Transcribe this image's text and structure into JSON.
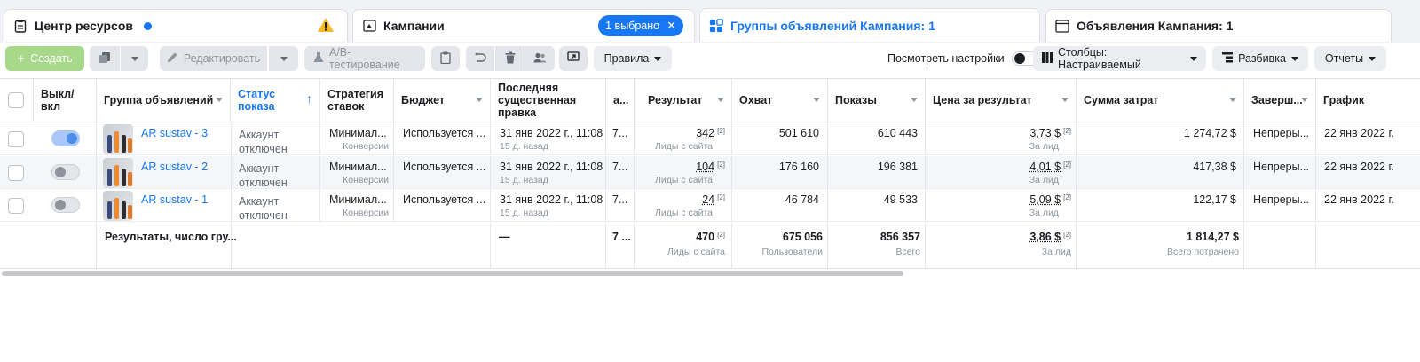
{
  "tabs": {
    "resources": "Центр ресурсов",
    "campaigns": "Кампании",
    "selected_pill": "1 выбрано",
    "adsets": "Группы объявлений Кампания: 1",
    "ads": "Объявления Кампания: 1"
  },
  "toolbar": {
    "create": "Создать",
    "edit": "Редактировать",
    "ab_test": "A/B-тестирование",
    "rules": "Правила",
    "view_settings": "Посмотреть настройки",
    "columns": "Столбцы: Настраиваемый",
    "breakdown": "Разбивка",
    "reports": "Отчеты"
  },
  "columns": {
    "onoff": "Выкл/ вкл",
    "adset": "Группа объявлений",
    "delivery": "Статус показа",
    "bid": "Стратегия ставок",
    "budget": "Бюджет",
    "last_edit": "Последняя существенная правка",
    "attr": "а...",
    "result": "Результат",
    "reach": "Охват",
    "impressions": "Показы",
    "cost": "Цена за результат",
    "spent": "Сумма затрат",
    "end": "Заверш...",
    "schedule": "График"
  },
  "rows": [
    {
      "toggle_on": true,
      "name": "AR sustav - 3",
      "delivery1": "Аккаунт",
      "delivery2": "отключен",
      "bid": "Минимал...",
      "bid_sub": "Конверсии",
      "budget": "Используется ...",
      "edit": "31 янв 2022 г., 11:08",
      "edit_sub": "15 д. назад",
      "attr": "7...",
      "result": "342",
      "result_sub": "Лиды с сайта",
      "reach": "501 610",
      "impressions": "610 443",
      "cost": "3,73 $",
      "cost_sub": "За лид",
      "spent": "1 274,72 $",
      "end": "Непреры...",
      "schedule": "22 янв 2022 г."
    },
    {
      "toggle_on": false,
      "name": "AR sustav - 2",
      "delivery1": "Аккаунт",
      "delivery2": "отключен",
      "bid": "Минимал...",
      "bid_sub": "Конверсии",
      "budget": "Используется ...",
      "edit": "31 янв 2022 г., 11:08",
      "edit_sub": "15 д. назад",
      "attr": "7...",
      "result": "104",
      "result_sub": "Лиды с сайта",
      "reach": "176 160",
      "impressions": "196 381",
      "cost": "4,01 $",
      "cost_sub": "За лид",
      "spent": "417,38 $",
      "end": "Непреры...",
      "schedule": "22 янв 2022 г."
    },
    {
      "toggle_on": false,
      "name": "AR sustav - 1",
      "delivery1": "Аккаунт",
      "delivery2": "отключен",
      "bid": "Минимал...",
      "bid_sub": "Конверсии",
      "budget": "Используется ...",
      "edit": "31 янв 2022 г., 11:08",
      "edit_sub": "15 д. назад",
      "attr": "7...",
      "result": "24",
      "result_sub": "Лиды с сайта",
      "reach": "46 784",
      "impressions": "49 533",
      "cost": "5,09 $",
      "cost_sub": "За лид",
      "spent": "122,17 $",
      "end": "Непреры...",
      "schedule": "22 янв 2022 г."
    }
  ],
  "totals": {
    "label": "Результаты, число гру...",
    "edit": "—",
    "attr": "7 ...",
    "result": "470",
    "result_sub": "Лиды с сайта",
    "reach": "675 056",
    "reach_sub": "Пользователи",
    "impressions": "856 357",
    "impressions_sub": "Всего",
    "cost": "3,86 $",
    "cost_sub": "За лид",
    "spent": "1 814,27 $",
    "spent_sub": "Всего потрачено"
  },
  "footnote_mark": "[2]"
}
